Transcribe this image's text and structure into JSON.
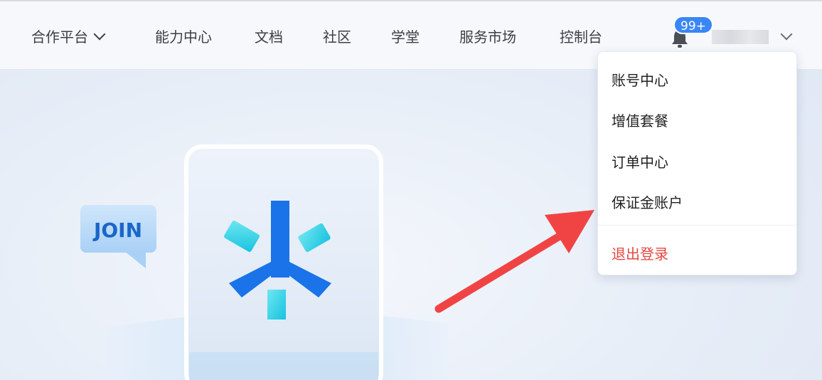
{
  "nav": {
    "items": [
      {
        "label": "合作平台",
        "has_dropdown": true
      },
      {
        "label": "能力中心"
      },
      {
        "label": "文档"
      },
      {
        "label": "社区"
      },
      {
        "label": "学堂"
      },
      {
        "label": "服务市场"
      },
      {
        "label": "控制台"
      }
    ]
  },
  "notifications": {
    "badge": "99+",
    "icon": "bell-icon"
  },
  "user_menu": {
    "icon": "chevron-down-icon",
    "items": [
      {
        "label": "账号中心"
      },
      {
        "label": "增值套餐"
      },
      {
        "label": "订单中心"
      },
      {
        "label": "保证金账户"
      }
    ],
    "logout_label": "退出登录"
  },
  "illustration": {
    "bubble_text": "JOIN"
  },
  "colors": {
    "accent_blue": "#1a73e8",
    "badge_blue": "#3a86f5",
    "logout_red": "#e5473f",
    "arrow_red": "#f04444"
  }
}
